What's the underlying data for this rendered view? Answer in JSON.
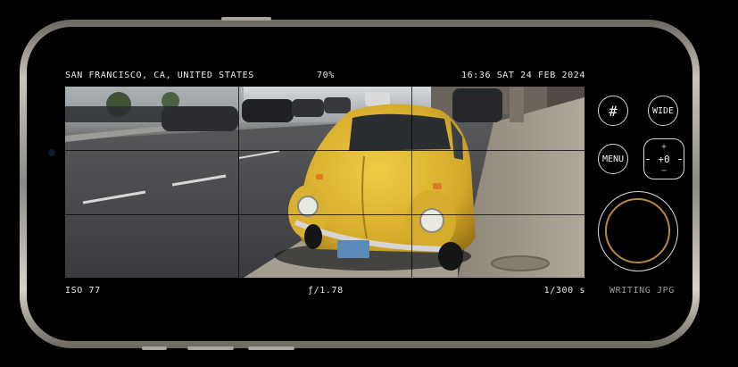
{
  "hud": {
    "location": "SAN FRANCISCO, CA, UNITED STATES",
    "zoom_percent": "70%",
    "datetime": "16:36 SAT 24 FEB 2024",
    "iso": "ISO 77",
    "aperture": "ƒ/1.78",
    "shutter_speed": "1/300 s",
    "status": "WRITING JPG"
  },
  "controls": {
    "grid_icon": "#",
    "lens_label": "WIDE",
    "menu_label": "MENU",
    "ev_plus": "+",
    "ev_value": "+0",
    "ev_minus": "−"
  },
  "colors": {
    "shutter_ring": "#b58a3c",
    "car_yellow": "#d9b42b",
    "text": "#e9e9e9"
  }
}
